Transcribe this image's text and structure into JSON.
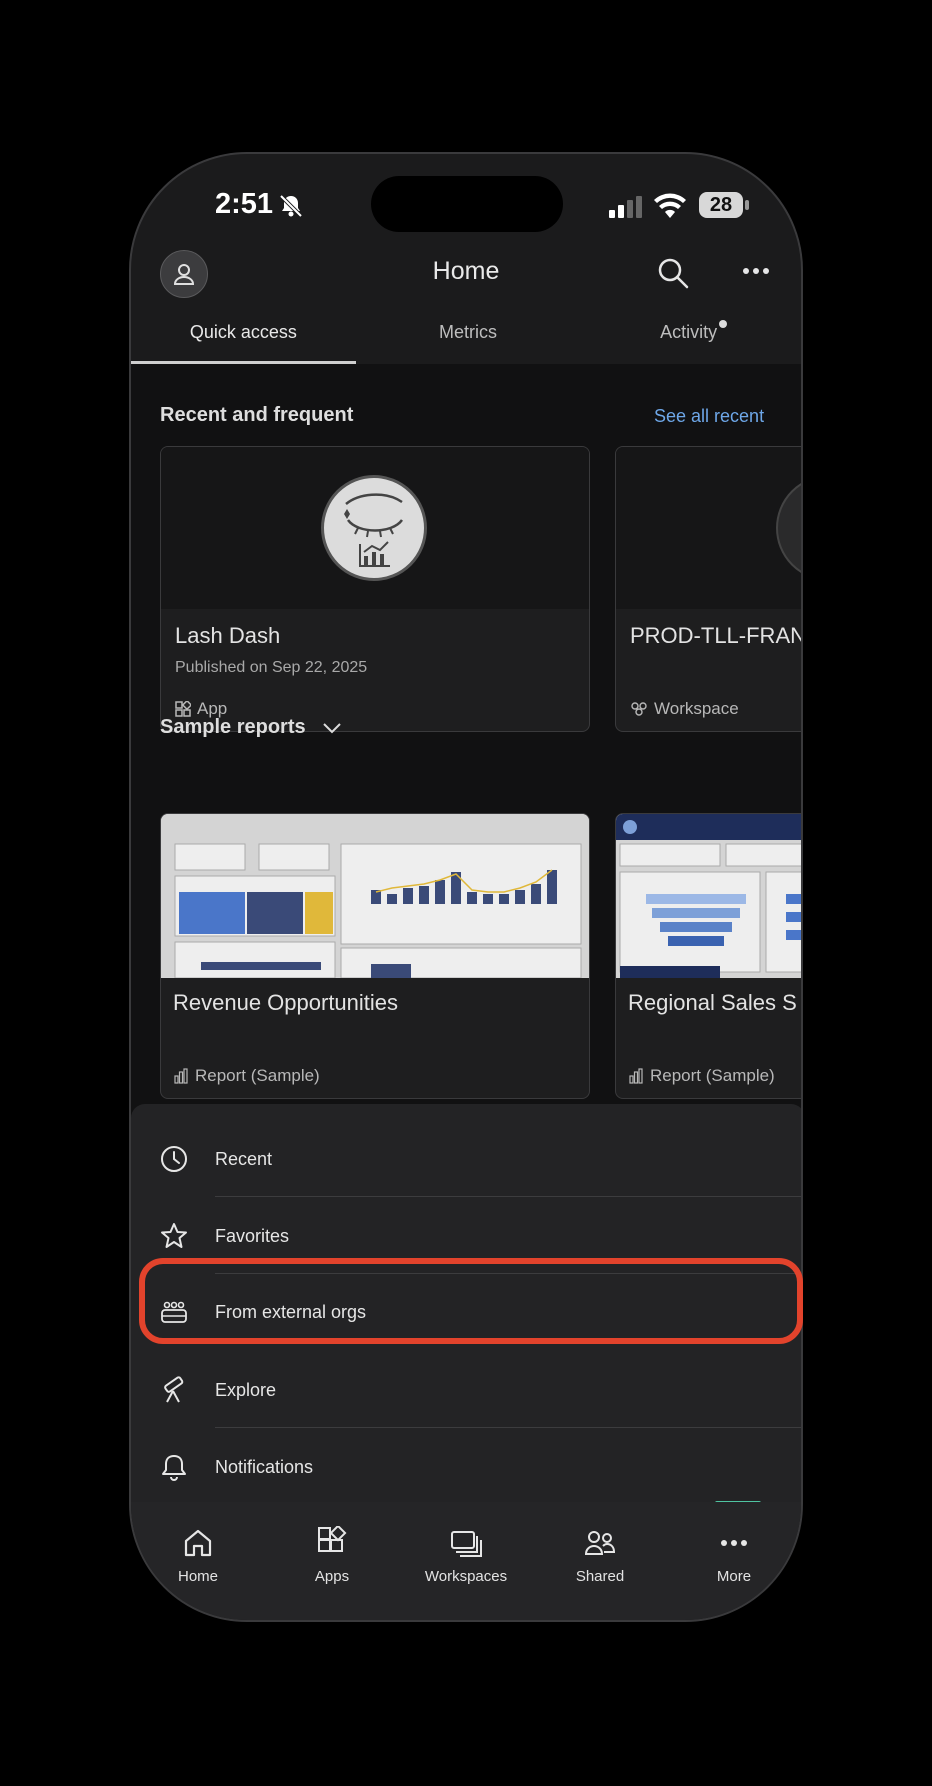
{
  "status_bar": {
    "time": "2:51",
    "battery": "28"
  },
  "header": {
    "title": "Home"
  },
  "tabs": [
    {
      "label": "Quick access"
    },
    {
      "label": "Metrics"
    },
    {
      "label": "Activity"
    }
  ],
  "recent": {
    "title": "Recent and frequent",
    "see_all": "See all recent",
    "cards": [
      {
        "name": "Lash Dash",
        "subtitle": "Published on Sep 22, 2025",
        "kind": "App"
      },
      {
        "name": "PROD-TLL-FRAN",
        "subtitle": "",
        "kind": "Workspace"
      }
    ]
  },
  "samples": {
    "title": "Sample reports",
    "cards": [
      {
        "name": "Revenue Opportunities",
        "kind": "Report (Sample)"
      },
      {
        "name": "Regional Sales S",
        "kind": "Report (Sample)"
      }
    ]
  },
  "menu": {
    "items": [
      {
        "label": "Recent",
        "icon": "clock-icon"
      },
      {
        "label": "Favorites",
        "icon": "star-icon"
      },
      {
        "label": "From external orgs",
        "icon": "external-orgs-icon"
      },
      {
        "label": "Explore",
        "icon": "telescope-icon"
      },
      {
        "label": "Notifications",
        "icon": "bell-icon"
      }
    ]
  },
  "tabbar": {
    "items": [
      {
        "label": "Home",
        "icon": "home-icon"
      },
      {
        "label": "Apps",
        "icon": "apps-icon"
      },
      {
        "label": "Workspaces",
        "icon": "workspaces-icon"
      },
      {
        "label": "Shared",
        "icon": "shared-icon"
      },
      {
        "label": "More",
        "icon": "more-icon"
      }
    ]
  },
  "colors": {
    "accent_link": "#6ea7e8",
    "highlight": "#e2432c",
    "active_indicator": "#4fc3a1"
  }
}
